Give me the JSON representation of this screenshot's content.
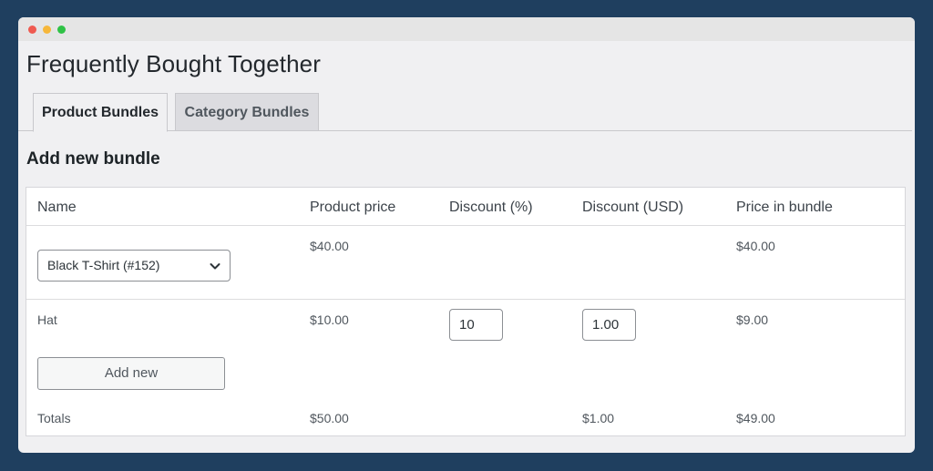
{
  "window": {
    "controls": [
      "close",
      "minimize",
      "maximize"
    ],
    "colors": {
      "close": "#ef5a50",
      "minimize": "#f6b73a",
      "maximize": "#2fc246",
      "background": "#1f3f5f"
    }
  },
  "page": {
    "title": "Frequently Bought Together"
  },
  "tabs": [
    {
      "label": "Product Bundles",
      "active": true
    },
    {
      "label": "Category Bundles",
      "active": false
    }
  ],
  "section": {
    "title": "Add new bundle"
  },
  "table": {
    "headers": {
      "name": "Name",
      "product_price": "Product price",
      "discount_pct": "Discount (%)",
      "discount_usd": "Discount (USD)",
      "price_in_bundle": "Price in bundle"
    },
    "rows": [
      {
        "name_select": "Black T-Shirt (#152)",
        "product_price": "$40.00",
        "discount_pct": "",
        "discount_usd": "",
        "price_in_bundle": "$40.00"
      },
      {
        "name": "Hat",
        "product_price": "$10.00",
        "discount_pct": "10",
        "discount_usd": "1.00",
        "price_in_bundle": "$9.00"
      }
    ],
    "add_button_label": "Add new",
    "totals": {
      "label": "Totals",
      "product_price": "$50.00",
      "discount_usd": "$1.00",
      "price_in_bundle": "$49.00"
    }
  }
}
